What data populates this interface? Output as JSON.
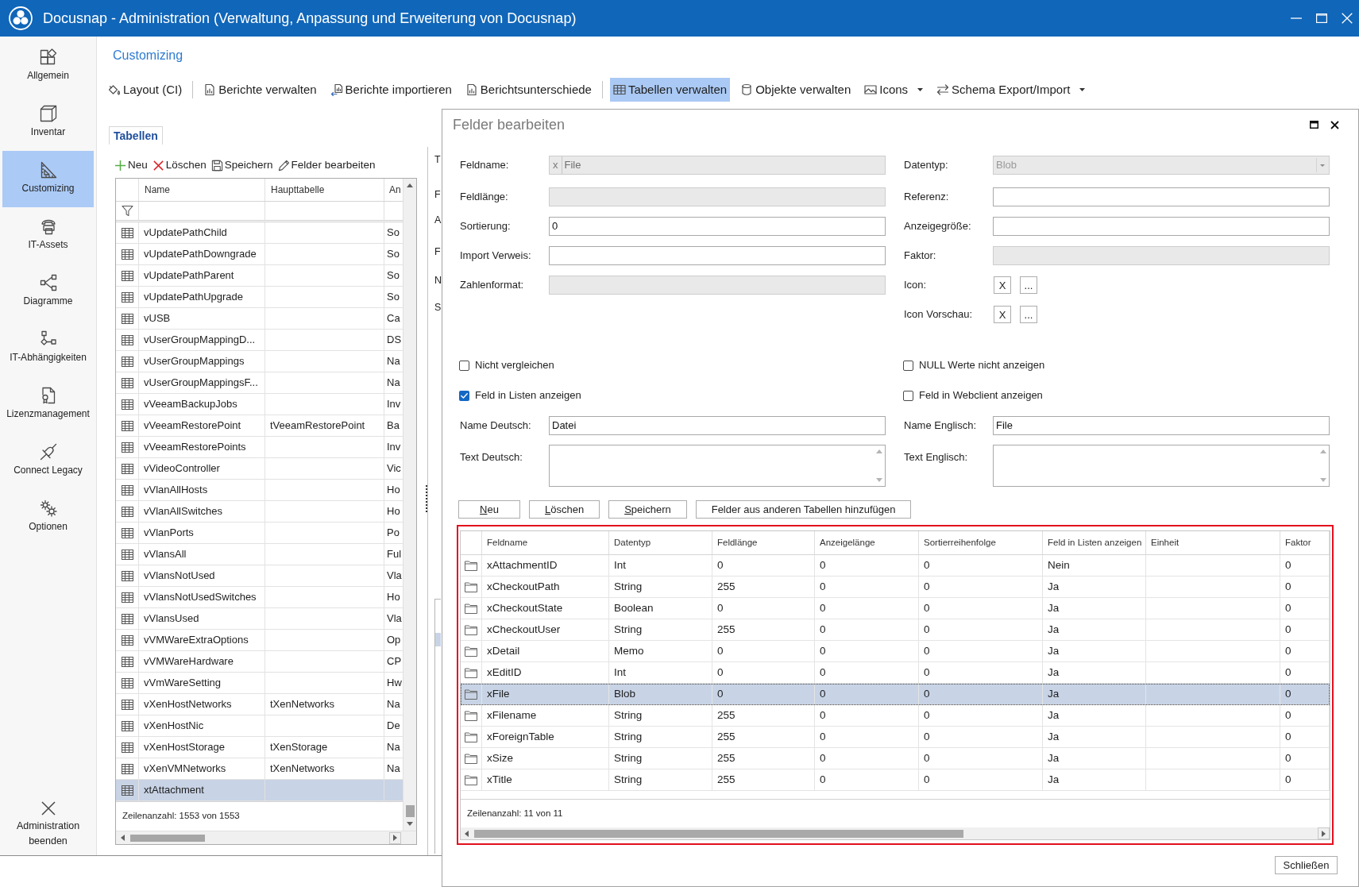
{
  "window": {
    "title": "Docusnap - Administration (Verwaltung, Anpassung und Erweiterung von Docusnap)"
  },
  "sidebar": {
    "items": [
      {
        "label": "Allgemein",
        "selected": false
      },
      {
        "label": "Inventar",
        "selected": false
      },
      {
        "label": "Customizing",
        "selected": true
      },
      {
        "label": "IT-Assets",
        "selected": false
      },
      {
        "label": "Diagramme",
        "selected": false
      },
      {
        "label": "IT-Abhängigkeiten",
        "selected": false
      },
      {
        "label": "Lizenzmanagement",
        "selected": false
      },
      {
        "label": "Connect Legacy",
        "selected": false
      },
      {
        "label": "Optionen",
        "selected": false
      }
    ],
    "exit": {
      "label": "Administration beenden"
    }
  },
  "section_title": "Customizing",
  "toolbar": {
    "items": [
      {
        "label": "Layout (CI)",
        "selected": false,
        "separator_after": true
      },
      {
        "label": "Berichte verwalten",
        "selected": false
      },
      {
        "label": "Berichte importieren",
        "selected": false
      },
      {
        "label": "Berichtsunterschiede",
        "selected": false,
        "separator_after": true
      },
      {
        "label": "Tabellen verwalten",
        "selected": true
      },
      {
        "label": "Objekte verwalten",
        "selected": false
      },
      {
        "label": "Icons",
        "selected": false,
        "dropdown": true
      },
      {
        "label": "Schema Export/Import",
        "selected": false,
        "dropdown": true
      }
    ]
  },
  "tabs": [
    {
      "label": "Tabellen",
      "selected": true
    }
  ],
  "tables_panel": {
    "toolbar": [
      "Neu",
      "Löschen",
      "Speichern",
      "Felder bearbeiten"
    ],
    "table": {
      "columns": [
        "Name",
        "Haupttabelle",
        "An"
      ],
      "rows": [
        {
          "name": "vUpdatePathChild",
          "column_3": "So",
          "selected": false
        },
        {
          "name": "vUpdatePathDowngrade",
          "column_3": "So",
          "selected": false
        },
        {
          "name": "vUpdatePathParent",
          "column_3": "So",
          "selected": false
        },
        {
          "name": "vUpdatePathUpgrade",
          "column_3": "So",
          "selected": false
        },
        {
          "name": "vUSB",
          "column_3": "Ca",
          "selected": false
        },
        {
          "name": "vUserGroupMappingD...",
          "column_3": "DS",
          "selected": false
        },
        {
          "name": "vUserGroupMappings",
          "column_3": "Na",
          "selected": false
        },
        {
          "name": "vUserGroupMappingsF...",
          "column_3": "Na",
          "selected": false
        },
        {
          "name": "vVeeamBackupJobs",
          "column_3": "Inv",
          "selected": false
        },
        {
          "name": "vVeeamRestorePoint",
          "haupttabelle": "tVeeamRestorePoint",
          "column_3": "Ba",
          "selected": false
        },
        {
          "name": "vVeeamRestorePoints",
          "column_3": "Inv",
          "selected": false
        },
        {
          "name": "vVideoController",
          "column_3": "Vic",
          "selected": false
        },
        {
          "name": "vVlanAllHosts",
          "column_3": "Ho",
          "selected": false
        },
        {
          "name": "vVlanAllSwitches",
          "column_3": "Ho",
          "selected": false
        },
        {
          "name": "vVlanPorts",
          "column_3": "Po",
          "selected": false
        },
        {
          "name": "vVlansAll",
          "column_3": "Ful",
          "selected": false
        },
        {
          "name": "vVlansNotUsed",
          "column_3": "Vla",
          "selected": false
        },
        {
          "name": "vVlansNotUsedSwitches",
          "column_3": "Ho",
          "selected": false
        },
        {
          "name": "vVlansUsed",
          "column_3": "Vla",
          "selected": false
        },
        {
          "name": "vVMWareExtraOptions",
          "column_3": "Op",
          "selected": false
        },
        {
          "name": "vVMWareHardware",
          "column_3": "CP",
          "selected": false
        },
        {
          "name": "vVmWareSetting",
          "column_3": "Hw",
          "selected": false
        },
        {
          "name": "vXenHostNetworks",
          "haupttabelle": "tXenNetworks",
          "column_3": "Na",
          "selected": false
        },
        {
          "name": "vXenHostNic",
          "column_3": "De",
          "selected": false
        },
        {
          "name": "vXenHostStorage",
          "haupttabelle": "tXenStorage",
          "column_3": "Na",
          "selected": false
        },
        {
          "name": "vXenVMNetworks",
          "haupttabelle": "tXenNetworks",
          "column_3": "Na",
          "selected": false
        },
        {
          "name": "xtAttachment",
          "selected": true
        }
      ],
      "row_count": "Zeilenanzahl: 1553 von 1553"
    }
  },
  "middle_panel": {
    "labels": [
      "T",
      "F",
      "A",
      "F",
      "N",
      "S"
    ]
  },
  "dialog": {
    "title": "Felder bearbeiten",
    "fields_left": [
      {
        "label": "Feldname:",
        "prefix": "x",
        "value": "File",
        "disabled": true
      },
      {
        "label": "Feldlänge:",
        "disabled": true
      },
      {
        "label": "Sortierung:",
        "value": "0",
        "disabled": false
      },
      {
        "label": "Import Verweis:",
        "disabled": false
      },
      {
        "label": "Zahlenformat:",
        "disabled": true
      }
    ],
    "fields_right": [
      {
        "kind": "select",
        "label": "Datentyp:",
        "value": "Blob",
        "disabled": true
      },
      {
        "kind": "text",
        "label": "Referenz:",
        "disabled": false
      },
      {
        "kind": "text",
        "label": "Anzeigegröße:",
        "disabled": false
      },
      {
        "kind": "text",
        "label": "Faktor:",
        "disabled": true
      },
      {
        "kind": "icon_picker",
        "label": "Icon:",
        "buttons": [
          "X",
          "..."
        ]
      },
      {
        "kind": "icon_picker",
        "label": "Icon Vorschau:",
        "buttons": [
          "X",
          "..."
        ]
      }
    ],
    "checkboxes_left": [
      {
        "label": "Nicht vergleichen",
        "checked": false
      },
      {
        "label": "Feld in Listen anzeigen",
        "checked": true
      }
    ],
    "checkboxes_right": [
      {
        "label": "NULL Werte nicht anzeigen",
        "checked": false
      },
      {
        "label": "Feld in Webclient anzeigen",
        "checked": false
      }
    ],
    "names": [
      {
        "label": "Name Deutsch:",
        "value": "Datei"
      },
      {
        "label": "Name Englisch:",
        "value": "File"
      }
    ],
    "texts": [
      {
        "label": "Text Deutsch:"
      },
      {
        "label": "Text Englisch:"
      }
    ],
    "buttons": [
      {
        "label": "Neu",
        "access_key": true
      },
      {
        "label": "Löschen",
        "access_key": true
      },
      {
        "label": "Speichern",
        "access_key": true
      },
      {
        "label": "Felder aus anderen Tabellen hinzufügen",
        "access_key": false
      }
    ],
    "grid": {
      "highlighted": true,
      "columns": [
        "Feldname",
        "Datentyp",
        "Feldlänge",
        "Anzeigelänge",
        "Sortierreihenfolge",
        "Feld in Listen anzeigen",
        "Einheit",
        "Faktor"
      ],
      "rows": [
        {
          "feldname": "xAttachmentID",
          "datentyp": "Int",
          "feldlaenge": "0",
          "anzeigelaenge": "0",
          "sortierreihenfolge": "0",
          "feld_in_listen_anzeigen": "Nein",
          "faktor": "0",
          "selected": false
        },
        {
          "feldname": "xCheckoutPath",
          "datentyp": "String",
          "feldlaenge": "255",
          "anzeigelaenge": "0",
          "sortierreihenfolge": "0",
          "feld_in_listen_anzeigen": "Ja",
          "faktor": "0",
          "selected": false
        },
        {
          "feldname": "xCheckoutState",
          "datentyp": "Boolean",
          "feldlaenge": "0",
          "anzeigelaenge": "0",
          "sortierreihenfolge": "0",
          "feld_in_listen_anzeigen": "Ja",
          "faktor": "0",
          "selected": false
        },
        {
          "feldname": "xCheckoutUser",
          "datentyp": "String",
          "feldlaenge": "255",
          "anzeigelaenge": "0",
          "sortierreihenfolge": "0",
          "feld_in_listen_anzeigen": "Ja",
          "faktor": "0",
          "selected": false
        },
        {
          "feldname": "xDetail",
          "datentyp": "Memo",
          "feldlaenge": "0",
          "anzeigelaenge": "0",
          "sortierreihenfolge": "0",
          "feld_in_listen_anzeigen": "Ja",
          "faktor": "0",
          "selected": false
        },
        {
          "feldname": "xEditID",
          "datentyp": "Int",
          "feldlaenge": "0",
          "anzeigelaenge": "0",
          "sortierreihenfolge": "0",
          "feld_in_listen_anzeigen": "Ja",
          "faktor": "0",
          "selected": false
        },
        {
          "feldname": "xFile",
          "datentyp": "Blob",
          "feldlaenge": "0",
          "anzeigelaenge": "0",
          "sortierreihenfolge": "0",
          "feld_in_listen_anzeigen": "Ja",
          "faktor": "0",
          "selected": true
        },
        {
          "feldname": "xFilename",
          "datentyp": "String",
          "feldlaenge": "255",
          "anzeigelaenge": "0",
          "sortierreihenfolge": "0",
          "feld_in_listen_anzeigen": "Ja",
          "faktor": "0",
          "selected": false
        },
        {
          "feldname": "xForeignTable",
          "datentyp": "String",
          "feldlaenge": "255",
          "anzeigelaenge": "0",
          "sortierreihenfolge": "0",
          "feld_in_listen_anzeigen": "Ja",
          "faktor": "0",
          "selected": false
        },
        {
          "feldname": "xSize",
          "datentyp": "String",
          "feldlaenge": "255",
          "anzeigelaenge": "0",
          "sortierreihenfolge": "0",
          "feld_in_listen_anzeigen": "Ja",
          "faktor": "0",
          "selected": false
        },
        {
          "feldname": "xTitle",
          "datentyp": "String",
          "feldlaenge": "255",
          "anzeigelaenge": "0",
          "sortierreihenfolge": "0",
          "feld_in_listen_anzeigen": "Ja",
          "faktor": "0",
          "selected": false
        }
      ],
      "row_count": "Zeilenanzahl: 11 von 11"
    },
    "close_button": "Schließen"
  }
}
